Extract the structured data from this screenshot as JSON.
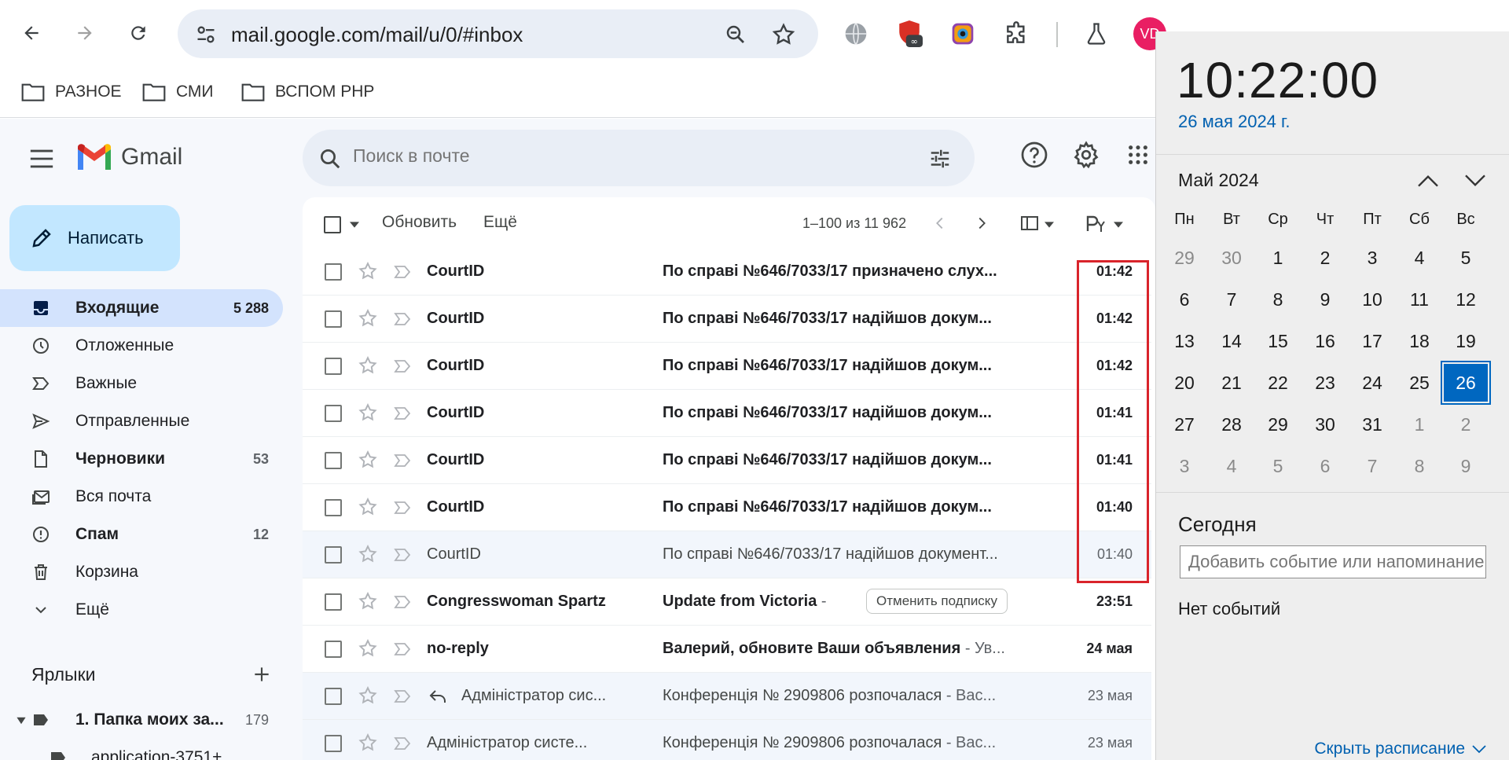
{
  "browser": {
    "url": "mail.google.com/mail/u/0/#inbox",
    "avatar_initials": "VD",
    "bookmarks": [
      {
        "label": "РАЗНОЕ"
      },
      {
        "label": "СМИ"
      },
      {
        "label": "ВСПОМ PHP"
      }
    ]
  },
  "gmail": {
    "logo_text": "Gmail",
    "search_placeholder": "Поиск в почте",
    "compose_label": "Написать",
    "nav": [
      {
        "label": "Входящие",
        "count": "5 288",
        "icon": "inbox-icon"
      },
      {
        "label": "Отложенные",
        "count": "",
        "icon": "clock-icon"
      },
      {
        "label": "Важные",
        "count": "",
        "icon": "important-icon"
      },
      {
        "label": "Отправленные",
        "count": "",
        "icon": "send-icon"
      },
      {
        "label": "Черновики",
        "count": "53",
        "icon": "draft-icon"
      },
      {
        "label": "Вся почта",
        "count": "",
        "icon": "all-mail-icon"
      },
      {
        "label": "Спам",
        "count": "12",
        "icon": "spam-icon"
      },
      {
        "label": "Корзина",
        "count": "",
        "icon": "trash-icon"
      },
      {
        "label": "Ещё",
        "count": "",
        "icon": "chevron-down-icon"
      }
    ],
    "labels_heading": "Ярлыки",
    "labels": [
      {
        "label": "1. Папка моих за...",
        "count": "179"
      },
      {
        "label": "application-3751+"
      }
    ],
    "toolbar": {
      "refresh": "Обновить",
      "more": "Ещё",
      "range": "1–100 из 11 962"
    },
    "emails": [
      {
        "sender": "CourtID",
        "subject": "По справі №646/7033/17 призначено слух...",
        "snippet": "",
        "date": "01:42",
        "unread": true
      },
      {
        "sender": "CourtID",
        "subject": "По справі №646/7033/17 надійшов докум...",
        "snippet": "",
        "date": "01:42",
        "unread": true
      },
      {
        "sender": "CourtID",
        "subject": "По справі №646/7033/17 надійшов докум...",
        "snippet": "",
        "date": "01:42",
        "unread": true
      },
      {
        "sender": "CourtID",
        "subject": "По справі №646/7033/17 надійшов докум...",
        "snippet": "",
        "date": "01:41",
        "unread": true
      },
      {
        "sender": "CourtID",
        "subject": "По справі №646/7033/17 надійшов докум...",
        "snippet": "",
        "date": "01:41",
        "unread": true
      },
      {
        "sender": "CourtID",
        "subject": "По справі №646/7033/17 надійшов докум...",
        "snippet": "",
        "date": "01:40",
        "unread": true
      },
      {
        "sender": "CourtID",
        "subject": "По справі №646/7033/17 надійшов документ...",
        "snippet": "",
        "date": "01:40",
        "unread": false
      },
      {
        "sender": "Congresswoman Spartz",
        "subject": "Update from Victoria",
        "snippet": " - ",
        "date": "23:51",
        "unread": true,
        "unsubscribe": "Отменить подписку"
      },
      {
        "sender": "no-reply",
        "subject": "Валерий, обновите Ваши объявления",
        "snippet": " - Ув...",
        "date": "24 мая",
        "unread": true
      },
      {
        "sender": "Адміністратор сис...",
        "subject": "Конференція № 2909806 розпочалася",
        "snippet": " - Вас...",
        "date": "23 мая",
        "unread": false
      },
      {
        "sender": "Адміністратор систе...",
        "subject": "Конференція № 2909806 розпочалася",
        "snippet": " - Вас...",
        "date": "23 мая",
        "unread": false
      }
    ]
  },
  "calendar": {
    "time": "10:22:00",
    "date": "26 мая 2024 г.",
    "month": "Май 2024",
    "weekdays": [
      "Пн",
      "Вт",
      "Ср",
      "Чт",
      "Пт",
      "Сб",
      "Вс"
    ],
    "weeks": [
      [
        "29",
        "30",
        "1",
        "2",
        "3",
        "4",
        "5"
      ],
      [
        "6",
        "7",
        "8",
        "9",
        "10",
        "11",
        "12"
      ],
      [
        "13",
        "14",
        "15",
        "16",
        "17",
        "18",
        "19"
      ],
      [
        "20",
        "21",
        "22",
        "23",
        "24",
        "25",
        "26"
      ],
      [
        "27",
        "28",
        "29",
        "30",
        "31",
        "1",
        "2"
      ],
      [
        "3",
        "4",
        "5",
        "6",
        "7",
        "8",
        "9"
      ]
    ],
    "today": "26",
    "today_heading": "Сегодня",
    "event_placeholder": "Добавить событие или напоминание",
    "no_events": "Нет событий",
    "hide_schedule": "Скрыть расписание"
  }
}
